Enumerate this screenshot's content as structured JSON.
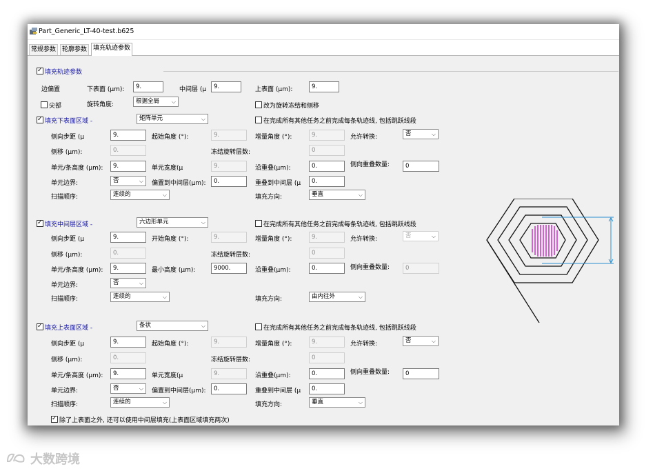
{
  "window": {
    "title": "Part_Generic_LT-40-test.b625"
  },
  "tabs": [
    "常规参数",
    "轮廓参数",
    "填充轨迹参数"
  ],
  "fill": {
    "enable_label": "填充轨迹参数",
    "edge_offset_label": "边偏置",
    "lower_label": "下表面 (μm):",
    "lower_value": "9.",
    "middle_label": "中间层 (μ",
    "middle_value": "9.",
    "upper_label": "上表面 (μm):",
    "upper_value": "9.",
    "tip_label": "尖部",
    "rotation_label": "旋转角度:",
    "rotation_value": "根据全局",
    "rotate_freeze_label": "改为旋转冻结和侧移"
  },
  "lower": {
    "title": "填充下表面区域 -",
    "pattern": "矩阵单元",
    "complete_label": "在完成所有其他任务之前完成每条轨迹线, 包括跳跃线段",
    "step_label": "侧向步距 (μ",
    "step_value": "9.",
    "start_angle_label": "起始角度 (°):",
    "start_angle_value": "9.",
    "inc_angle_label": "增量角度 (°):",
    "inc_angle_value": "9.",
    "allow_label": "允许转换:",
    "allow_value": "否",
    "shift_label": "侧移 (μm):",
    "shift_value": "0.",
    "freeze_label": "冻结旋转层数:",
    "freeze_value": "0",
    "cell_height_label": "单元/条高度 (μm):",
    "cell_height_value": "9.",
    "cell_width_label": "单元宽度(μ",
    "cell_width_value": "9.",
    "overlap_label": "沿重叠(μm):",
    "overlap_value": "0.",
    "side_overlap_label": "侧向重叠数量:",
    "side_overlap_value": "0",
    "border_label": "单元边界:",
    "border_value": "否",
    "offset_mid_label": "偏置到中间层(μm):",
    "offset_mid_value": "0.",
    "overlap_mid_label": "重叠到中间层 (μ",
    "overlap_mid_value": "0.",
    "scan_label": "扫描顺序:",
    "scan_value": "连续的",
    "dir_label": "填充方向:",
    "dir_value": "垂直"
  },
  "middle": {
    "title": "填充中间层区域 -",
    "pattern": "六边形单元",
    "complete_label": "在完成所有其他任务之前完成每条轨迹线, 包括跳跃线段",
    "step_label": "侧向步距 (μ",
    "step_value": "9.",
    "start_angle_label": "开始角度 (°):",
    "start_angle_value": "9.",
    "inc_angle_label": "增量角度 (°):",
    "inc_angle_value": "9.",
    "allow_label": "允许转换:",
    "allow_value": "否",
    "shift_label": "侧移 (μm):",
    "shift_value": "0.",
    "freeze_label": "冻结旋转层数:",
    "freeze_value": "0",
    "cell_height_label": "单元/条高度 (μm):",
    "cell_height_value": "9.",
    "min_height_label": "最小高度 (μm):",
    "min_height_value": "9000.",
    "overlap_label": "沿重叠(μm):",
    "overlap_value": "0.",
    "side_overlap_label": "侧向重叠数量:",
    "side_overlap_value": "0",
    "border_label": "单元边界:",
    "border_value": "否",
    "scan_label": "扫描顺序:",
    "scan_value": "连续的",
    "dir_label": "填充方向:",
    "dir_value": "由内往外"
  },
  "upper": {
    "title": "填充上表面区域 -",
    "pattern": "条状",
    "complete_label": "在完成所有其他任务之前完成每条轨迹线, 包括跳跃线段",
    "step_label": "侧向步距 (μ",
    "step_value": "9.",
    "start_angle_label": "起始角度 (°):",
    "start_angle_value": "9.",
    "inc_angle_label": "增量角度 (°):",
    "inc_angle_value": "9.",
    "allow_label": "允许转换:",
    "allow_value": "否",
    "shift_label": "侧移 (μm):",
    "shift_value": "0.",
    "freeze_label": "冻结旋转层数:",
    "freeze_value": "0",
    "cell_height_label": "单元/条高度 (μm):",
    "cell_height_value": "9.",
    "cell_width_label": "单元宽度(μ",
    "cell_width_value": "9.",
    "overlap_label": "沿重叠(μm):",
    "overlap_value": "0.",
    "side_overlap_label": "侧向重叠数量:",
    "side_overlap_value": "0",
    "border_label": "单元边界:",
    "border_value": "否",
    "offset_mid_label": "偏置到中间层(μm):",
    "offset_mid_value": "0.",
    "overlap_mid_label": "重叠到中间层 (μ",
    "overlap_mid_value": "0.",
    "scan_label": "扫描顺序:",
    "scan_value": "连续的",
    "dir_label": "填充方向:",
    "dir_value": "垂直"
  },
  "footer": {
    "extra_fill_label": "除了上表面之外, 还可以使用中间层填充(上表面区域填充两次)"
  },
  "watermark": "大数跨境",
  "colors": {
    "section": "#1a1aa8",
    "hatch": "#c000c0",
    "dimension": "#2a8fd0"
  }
}
